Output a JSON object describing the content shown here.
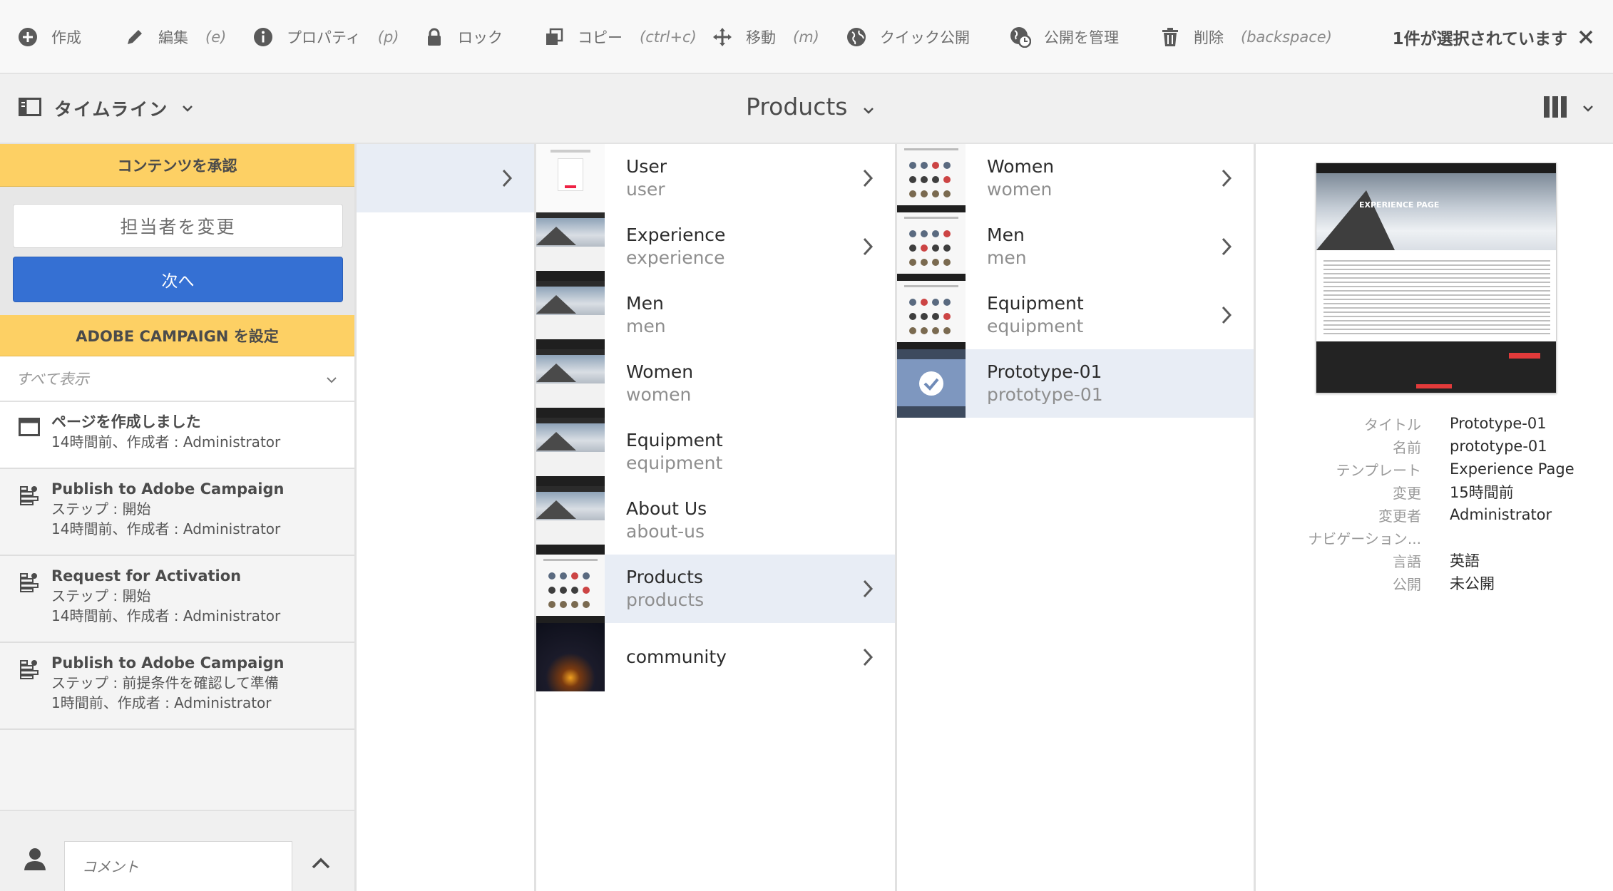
{
  "actionbar": {
    "actions": [
      {
        "label": "作成",
        "shortcut": "",
        "icon": "add-circle-icon"
      },
      {
        "label": "編集",
        "shortcut": "(e)",
        "icon": "pencil-icon"
      },
      {
        "label": "プロパティ",
        "shortcut": "(p)",
        "icon": "info-icon"
      },
      {
        "label": "ロック",
        "shortcut": "",
        "icon": "lock-icon"
      },
      {
        "label": "コピー",
        "shortcut": "(ctrl+c)",
        "icon": "copy-icon"
      },
      {
        "label": "移動",
        "shortcut": "(m)",
        "icon": "move-icon"
      },
      {
        "label": "クイック公開",
        "shortcut": "",
        "icon": "globe-icon"
      },
      {
        "label": "公開を管理",
        "shortcut": "",
        "icon": "globe-clock-icon"
      },
      {
        "label": "削除",
        "shortcut": "(backspace)",
        "icon": "trash-icon"
      }
    ],
    "selection_text": "1件が選択されています"
  },
  "header": {
    "rail_label": "タイムライン",
    "title": "Products"
  },
  "rail": {
    "alert1": "コンテンツを承認",
    "change_assignee": "担当者を変更",
    "next": "次へ",
    "alert2": "ADOBE CAMPAIGN を設定",
    "filter": "すべて表示",
    "events": [
      {
        "title": "ページを作成しました",
        "step": "",
        "meta": "14時間前、作成者 : Administrator"
      },
      {
        "title": "Publish to Adobe Campaign",
        "step": "ステップ : 開始",
        "meta": "14時間前、作成者 : Administrator"
      },
      {
        "title": "Request for Activation",
        "step": "ステップ : 開始",
        "meta": "14時間前、作成者 : Administrator"
      },
      {
        "title": "Publish to Adobe Campaign",
        "step": "ステップ : 前提条件を確認して準備",
        "meta": "1時間前、作成者 : Administrator"
      }
    ],
    "comment_placeholder": "コメント"
  },
  "column2": [
    {
      "title": "User",
      "name": "user",
      "has_children": true
    },
    {
      "title": "Experience",
      "name": "experience",
      "has_children": true
    },
    {
      "title": "Men",
      "name": "men",
      "has_children": false
    },
    {
      "title": "Women",
      "name": "women",
      "has_children": false
    },
    {
      "title": "Equipment",
      "name": "equipment",
      "has_children": false
    },
    {
      "title": "About Us",
      "name": "about-us",
      "has_children": false
    },
    {
      "title": "Products",
      "name": "products",
      "has_children": true
    },
    {
      "title": "community",
      "name": "",
      "has_children": true
    }
  ],
  "column3": [
    {
      "title": "Women",
      "name": "women",
      "has_children": true
    },
    {
      "title": "Men",
      "name": "men",
      "has_children": true
    },
    {
      "title": "Equipment",
      "name": "equipment",
      "has_children": true
    },
    {
      "title": "Prototype-01",
      "name": "prototype-01",
      "has_children": false
    }
  ],
  "details": {
    "preview_heading": "EXPERIENCE PAGE",
    "labels": {
      "title": "タイトル",
      "name": "名前",
      "template": "テンプレート",
      "modified": "変更",
      "modified_by": "変更者",
      "navigation": "ナビゲーション...",
      "language": "言語",
      "published": "公開"
    },
    "values": {
      "title": "Prototype-01",
      "name": "prototype-01",
      "template": "Experience Page",
      "modified": "15時間前",
      "modified_by": "Administrator",
      "navigation": "",
      "language": "英語",
      "published": "未公開"
    }
  },
  "colors": {
    "alert": "#fdd064",
    "primary": "#3570d3",
    "selected_row": "#e8edf5"
  }
}
